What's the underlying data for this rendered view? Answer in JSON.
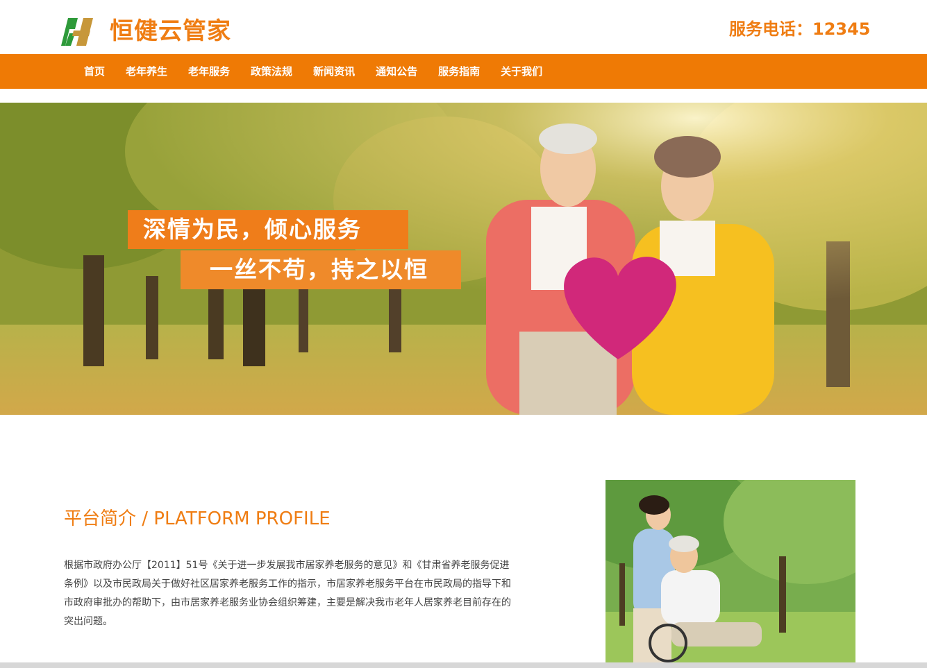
{
  "header": {
    "logo_text": "恒健云管家",
    "hotline": "服务电话：12345",
    "colors": {
      "accent": "#ef7d13",
      "logo_green": "#2e9a3a",
      "logo_gold": "#c7973a"
    }
  },
  "nav": {
    "background": "#ef7a05",
    "items": [
      {
        "label": "首页"
      },
      {
        "label": "老年养生"
      },
      {
        "label": "老年服务"
      },
      {
        "label": "政策法规"
      },
      {
        "label": "新闻资讯"
      },
      {
        "label": "通知公告"
      },
      {
        "label": "服务指南"
      },
      {
        "label": "关于我们"
      }
    ]
  },
  "banner": {
    "slogan_line1": "深情为民，倾心服务",
    "slogan_line2": "一丝不苟，持之以恒"
  },
  "profile": {
    "title": "平台简介 / PLATFORM PROFILE",
    "body": "根据市政府办公厅【2011】51号《关于进一步发展我市居家养老服务的意见》和《甘肃省养老服务促进条例》以及市民政局关于做好社区居家养老服务工作的指示，市居家养老服务平台在市民政局的指导下和市政府审批办的帮助下，由市居家养老服务业协会组织筹建，主要是解决我市老年人居家养老目前存在的突出问题。"
  }
}
